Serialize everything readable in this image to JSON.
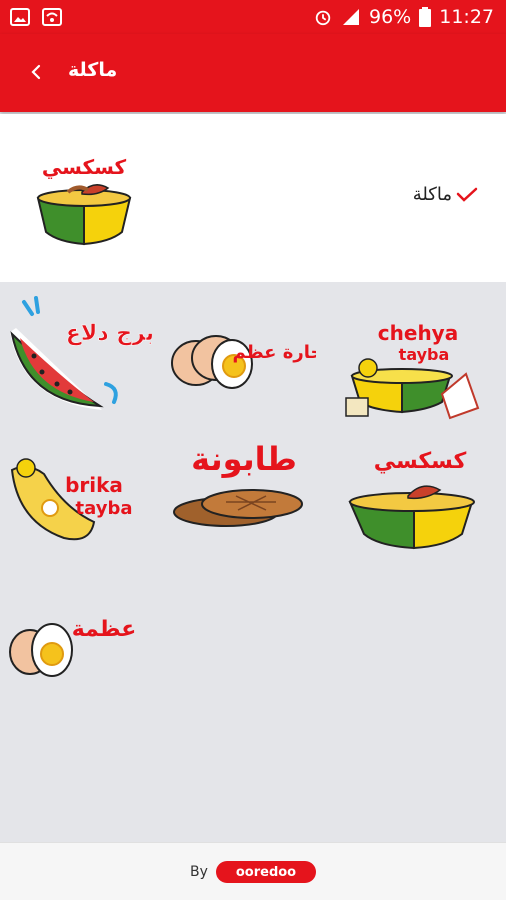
{
  "status_bar": {
    "battery": "96%",
    "time": "11:27"
  },
  "app_bar": {
    "title": "ماكلة"
  },
  "pack": {
    "name": "ماكلة"
  },
  "stickers": [
    {
      "name": "watermelon-sticker",
      "text": "برج دلاع"
    },
    {
      "name": "eggs-sticker",
      "text": "حارة عظم"
    },
    {
      "name": "chehya-sticker",
      "text_line1": "chehya",
      "text_line2": "tayba"
    },
    {
      "name": "brika-sticker",
      "text_line1": "brika",
      "text_line2": "tayba"
    },
    {
      "name": "tabouna-sticker",
      "text": "طابونة"
    },
    {
      "name": "couscous-sticker",
      "text": "كسكسي"
    },
    {
      "name": "egg-sticker",
      "text": "عظمة"
    }
  ],
  "footer": {
    "by": "By",
    "brand": "ooredoo"
  },
  "colors": {
    "accent": "#e5141c",
    "bowl_green": "#3f8f2b",
    "bowl_yellow": "#f5d20c"
  }
}
